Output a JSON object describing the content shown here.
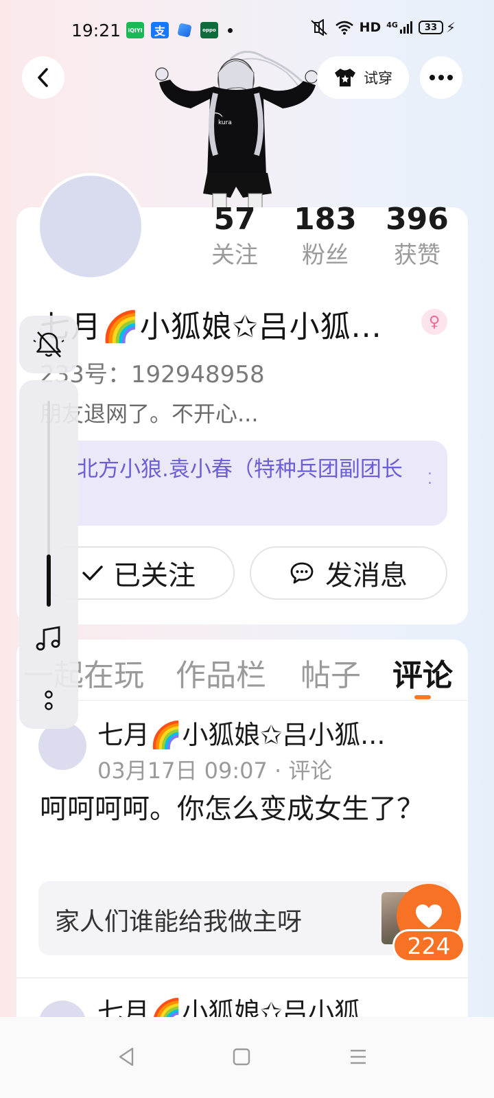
{
  "status_bar": {
    "time": "19:21",
    "app_icons": [
      {
        "name": "iqiyi-icon",
        "label": "iQIYI"
      },
      {
        "name": "alipay-icon",
        "label": "支"
      },
      {
        "name": "blue-app-icon",
        "label": ""
      },
      {
        "name": "oppo-icon",
        "label": "oppo"
      }
    ],
    "network_label": "HD",
    "signal_label": "4G",
    "battery": "33"
  },
  "header": {
    "try_on_label": "试穿"
  },
  "profile": {
    "stats": [
      {
        "value": "57",
        "label": "关注"
      },
      {
        "value": "183",
        "label": "粉丝"
      },
      {
        "value": "396",
        "label": "获赞"
      }
    ],
    "nickname": "七月🌈小狐娘✩吕小狐...",
    "uid": "233号：192948958",
    "bio": "朋友退网了。不开心...",
    "tag_text": "北方小狼.袁小春（特种兵团副团长",
    "follow_label": "已关注",
    "message_label": "发消息"
  },
  "tabs": [
    {
      "label": "一起在玩",
      "active": false
    },
    {
      "label": "作品栏",
      "active": false
    },
    {
      "label": "帖子",
      "active": false
    },
    {
      "label": "评论",
      "active": true
    }
  ],
  "posts": [
    {
      "author": "七月🌈小狐娘✩吕小狐...",
      "meta": "03月17日 09:07 · 评论",
      "content": "呵呵呵呵。你怎么变成女生了？",
      "quote": "家人们谁能给我做主呀"
    },
    {
      "author": "七月🌈小狐娘✩吕小狐..."
    }
  ],
  "like": {
    "count": "224"
  },
  "colors": {
    "accent_orange": "#f77224",
    "tag_purple": "#6b5fd6",
    "avatar_placeholder": "#d9dcef"
  }
}
